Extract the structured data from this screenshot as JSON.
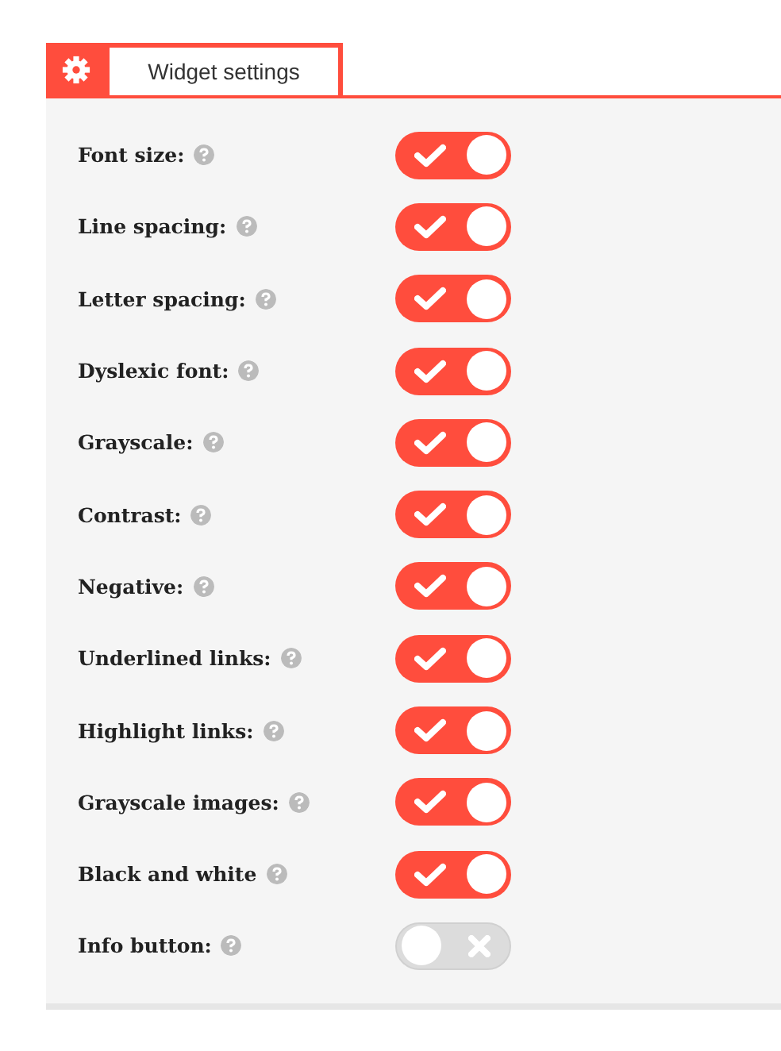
{
  "tab": {
    "label": "Widget settings",
    "selected": true
  },
  "settings": [
    {
      "label": "Font size:",
      "on": true
    },
    {
      "label": "Line spacing:",
      "on": true
    },
    {
      "label": "Letter spacing:",
      "on": true
    },
    {
      "label": "Dyslexic font:",
      "on": true
    },
    {
      "label": "Grayscale:",
      "on": true
    },
    {
      "label": "Contrast:",
      "on": true
    },
    {
      "label": "Negative:",
      "on": true
    },
    {
      "label": "Underlined links:",
      "on": true
    },
    {
      "label": "Highlight links:",
      "on": true
    },
    {
      "label": "Grayscale images:",
      "on": true
    },
    {
      "label": "Black and white",
      "on": true
    },
    {
      "label": "Info button:",
      "on": false
    }
  ]
}
